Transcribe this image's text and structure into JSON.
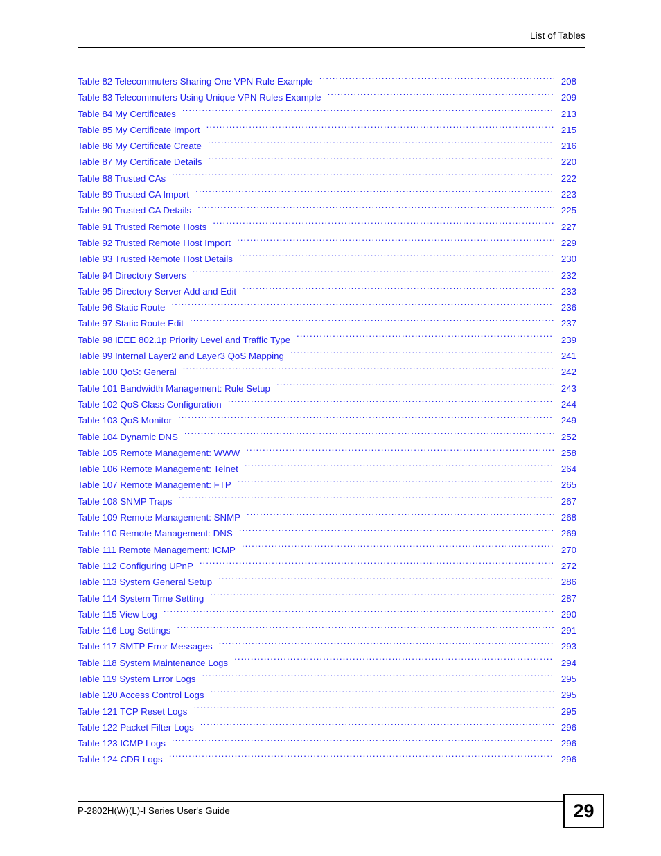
{
  "header": {
    "title": "List of Tables"
  },
  "footer": {
    "guide_title": "P-2802H(W)(L)-I Series User's Guide",
    "page_number": "29"
  },
  "toc": {
    "entries": [
      {
        "label": "Table 82 Telecommuters Sharing One VPN Rule Example",
        "page": "208"
      },
      {
        "label": "Table 83 Telecommuters Using Unique VPN Rules Example",
        "page": "209"
      },
      {
        "label": "Table 84 My Certificates",
        "page": "213"
      },
      {
        "label": "Table 85 My Certificate Import",
        "page": "215"
      },
      {
        "label": "Table 86 My Certificate Create",
        "page": "216"
      },
      {
        "label": "Table 87 My Certificate Details",
        "page": "220"
      },
      {
        "label": "Table 88 Trusted CAs",
        "page": "222"
      },
      {
        "label": "Table 89 Trusted CA Import",
        "page": "223"
      },
      {
        "label": "Table 90 Trusted CA Details",
        "page": "225"
      },
      {
        "label": "Table 91 Trusted Remote Hosts",
        "page": "227"
      },
      {
        "label": "Table 92 Trusted Remote Host Import",
        "page": "229"
      },
      {
        "label": "Table 93 Trusted Remote Host Details",
        "page": "230"
      },
      {
        "label": "Table 94 Directory Servers",
        "page": "232"
      },
      {
        "label": "Table 95 Directory Server Add and Edit",
        "page": "233"
      },
      {
        "label": "Table 96 Static Route",
        "page": "236"
      },
      {
        "label": "Table 97 Static Route Edit",
        "page": "237"
      },
      {
        "label": "Table 98 IEEE 802.1p Priority Level and Traffic Type",
        "page": "239"
      },
      {
        "label": "Table 99 Internal Layer2 and Layer3 QoS Mapping",
        "page": "241"
      },
      {
        "label": "Table 100 QoS: General",
        "page": "242"
      },
      {
        "label": "Table 101 Bandwidth Management: Rule Setup",
        "page": "243"
      },
      {
        "label": "Table 102 QoS Class Configuration",
        "page": "244"
      },
      {
        "label": "Table 103 QoS Monitor",
        "page": "249"
      },
      {
        "label": "Table 104 Dynamic DNS",
        "page": "252"
      },
      {
        "label": "Table 105 Remote Management: WWW",
        "page": "258"
      },
      {
        "label": "Table 106 Remote Management: Telnet",
        "page": "264"
      },
      {
        "label": "Table 107 Remote Management: FTP",
        "page": "265"
      },
      {
        "label": "Table 108 SNMP Traps",
        "page": "267"
      },
      {
        "label": "Table 109 Remote Management: SNMP",
        "page": "268"
      },
      {
        "label": "Table 110 Remote Management: DNS",
        "page": "269"
      },
      {
        "label": "Table 111 Remote Management: ICMP",
        "page": "270"
      },
      {
        "label": "Table 112 Configuring UPnP",
        "page": "272"
      },
      {
        "label": "Table 113 System General Setup",
        "page": "286"
      },
      {
        "label": "Table 114 System Time Setting",
        "page": "287"
      },
      {
        "label": "Table 115 View Log",
        "page": "290"
      },
      {
        "label": "Table 116 Log Settings",
        "page": "291"
      },
      {
        "label": "Table 117 SMTP Error Messages",
        "page": "293"
      },
      {
        "label": "Table 118 System Maintenance Logs",
        "page": "294"
      },
      {
        "label": "Table 119 System Error Logs",
        "page": "295"
      },
      {
        "label": "Table 120 Access Control Logs",
        "page": "295"
      },
      {
        "label": "Table 121 TCP Reset Logs",
        "page": "295"
      },
      {
        "label": "Table 122 Packet Filter Logs",
        "page": "296"
      },
      {
        "label": "Table 123 ICMP Logs",
        "page": "296"
      },
      {
        "label": "Table 124 CDR Logs",
        "page": "296"
      }
    ]
  },
  "colors": {
    "link_blue": "#2020ee",
    "text_black": "#000000",
    "page_background": "#ffffff"
  }
}
